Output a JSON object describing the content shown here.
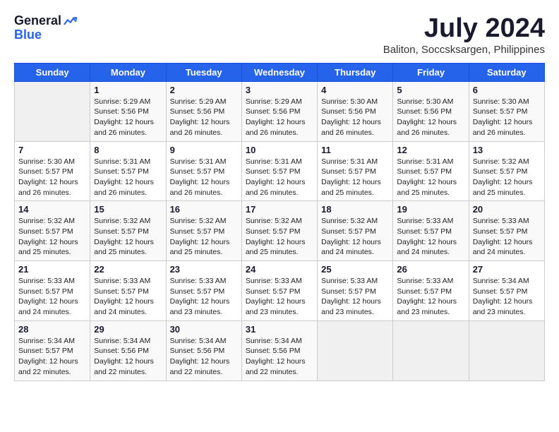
{
  "header": {
    "logo_general": "General",
    "logo_blue": "Blue",
    "month_year": "July 2024",
    "location": "Baliton, Soccsksargen, Philippines"
  },
  "weekdays": [
    "Sunday",
    "Monday",
    "Tuesday",
    "Wednesday",
    "Thursday",
    "Friday",
    "Saturday"
  ],
  "weeks": [
    [
      {
        "day": "",
        "info": ""
      },
      {
        "day": "1",
        "info": "Sunrise: 5:29 AM\nSunset: 5:56 PM\nDaylight: 12 hours\nand 26 minutes."
      },
      {
        "day": "2",
        "info": "Sunrise: 5:29 AM\nSunset: 5:56 PM\nDaylight: 12 hours\nand 26 minutes."
      },
      {
        "day": "3",
        "info": "Sunrise: 5:29 AM\nSunset: 5:56 PM\nDaylight: 12 hours\nand 26 minutes."
      },
      {
        "day": "4",
        "info": "Sunrise: 5:30 AM\nSunset: 5:56 PM\nDaylight: 12 hours\nand 26 minutes."
      },
      {
        "day": "5",
        "info": "Sunrise: 5:30 AM\nSunset: 5:56 PM\nDaylight: 12 hours\nand 26 minutes."
      },
      {
        "day": "6",
        "info": "Sunrise: 5:30 AM\nSunset: 5:57 PM\nDaylight: 12 hours\nand 26 minutes."
      }
    ],
    [
      {
        "day": "7",
        "info": "Sunrise: 5:30 AM\nSunset: 5:57 PM\nDaylight: 12 hours\nand 26 minutes."
      },
      {
        "day": "8",
        "info": "Sunrise: 5:31 AM\nSunset: 5:57 PM\nDaylight: 12 hours\nand 26 minutes."
      },
      {
        "day": "9",
        "info": "Sunrise: 5:31 AM\nSunset: 5:57 PM\nDaylight: 12 hours\nand 26 minutes."
      },
      {
        "day": "10",
        "info": "Sunrise: 5:31 AM\nSunset: 5:57 PM\nDaylight: 12 hours\nand 26 minutes."
      },
      {
        "day": "11",
        "info": "Sunrise: 5:31 AM\nSunset: 5:57 PM\nDaylight: 12 hours\nand 25 minutes."
      },
      {
        "day": "12",
        "info": "Sunrise: 5:31 AM\nSunset: 5:57 PM\nDaylight: 12 hours\nand 25 minutes."
      },
      {
        "day": "13",
        "info": "Sunrise: 5:32 AM\nSunset: 5:57 PM\nDaylight: 12 hours\nand 25 minutes."
      }
    ],
    [
      {
        "day": "14",
        "info": "Sunrise: 5:32 AM\nSunset: 5:57 PM\nDaylight: 12 hours\nand 25 minutes."
      },
      {
        "day": "15",
        "info": "Sunrise: 5:32 AM\nSunset: 5:57 PM\nDaylight: 12 hours\nand 25 minutes."
      },
      {
        "day": "16",
        "info": "Sunrise: 5:32 AM\nSunset: 5:57 PM\nDaylight: 12 hours\nand 25 minutes."
      },
      {
        "day": "17",
        "info": "Sunrise: 5:32 AM\nSunset: 5:57 PM\nDaylight: 12 hours\nand 25 minutes."
      },
      {
        "day": "18",
        "info": "Sunrise: 5:32 AM\nSunset: 5:57 PM\nDaylight: 12 hours\nand 24 minutes."
      },
      {
        "day": "19",
        "info": "Sunrise: 5:33 AM\nSunset: 5:57 PM\nDaylight: 12 hours\nand 24 minutes."
      },
      {
        "day": "20",
        "info": "Sunrise: 5:33 AM\nSunset: 5:57 PM\nDaylight: 12 hours\nand 24 minutes."
      }
    ],
    [
      {
        "day": "21",
        "info": "Sunrise: 5:33 AM\nSunset: 5:57 PM\nDaylight: 12 hours\nand 24 minutes."
      },
      {
        "day": "22",
        "info": "Sunrise: 5:33 AM\nSunset: 5:57 PM\nDaylight: 12 hours\nand 24 minutes."
      },
      {
        "day": "23",
        "info": "Sunrise: 5:33 AM\nSunset: 5:57 PM\nDaylight: 12 hours\nand 23 minutes."
      },
      {
        "day": "24",
        "info": "Sunrise: 5:33 AM\nSunset: 5:57 PM\nDaylight: 12 hours\nand 23 minutes."
      },
      {
        "day": "25",
        "info": "Sunrise: 5:33 AM\nSunset: 5:57 PM\nDaylight: 12 hours\nand 23 minutes."
      },
      {
        "day": "26",
        "info": "Sunrise: 5:33 AM\nSunset: 5:57 PM\nDaylight: 12 hours\nand 23 minutes."
      },
      {
        "day": "27",
        "info": "Sunrise: 5:34 AM\nSunset: 5:57 PM\nDaylight: 12 hours\nand 23 minutes."
      }
    ],
    [
      {
        "day": "28",
        "info": "Sunrise: 5:34 AM\nSunset: 5:57 PM\nDaylight: 12 hours\nand 22 minutes."
      },
      {
        "day": "29",
        "info": "Sunrise: 5:34 AM\nSunset: 5:56 PM\nDaylight: 12 hours\nand 22 minutes."
      },
      {
        "day": "30",
        "info": "Sunrise: 5:34 AM\nSunset: 5:56 PM\nDaylight: 12 hours\nand 22 minutes."
      },
      {
        "day": "31",
        "info": "Sunrise: 5:34 AM\nSunset: 5:56 PM\nDaylight: 12 hours\nand 22 minutes."
      },
      {
        "day": "",
        "info": ""
      },
      {
        "day": "",
        "info": ""
      },
      {
        "day": "",
        "info": ""
      }
    ]
  ]
}
